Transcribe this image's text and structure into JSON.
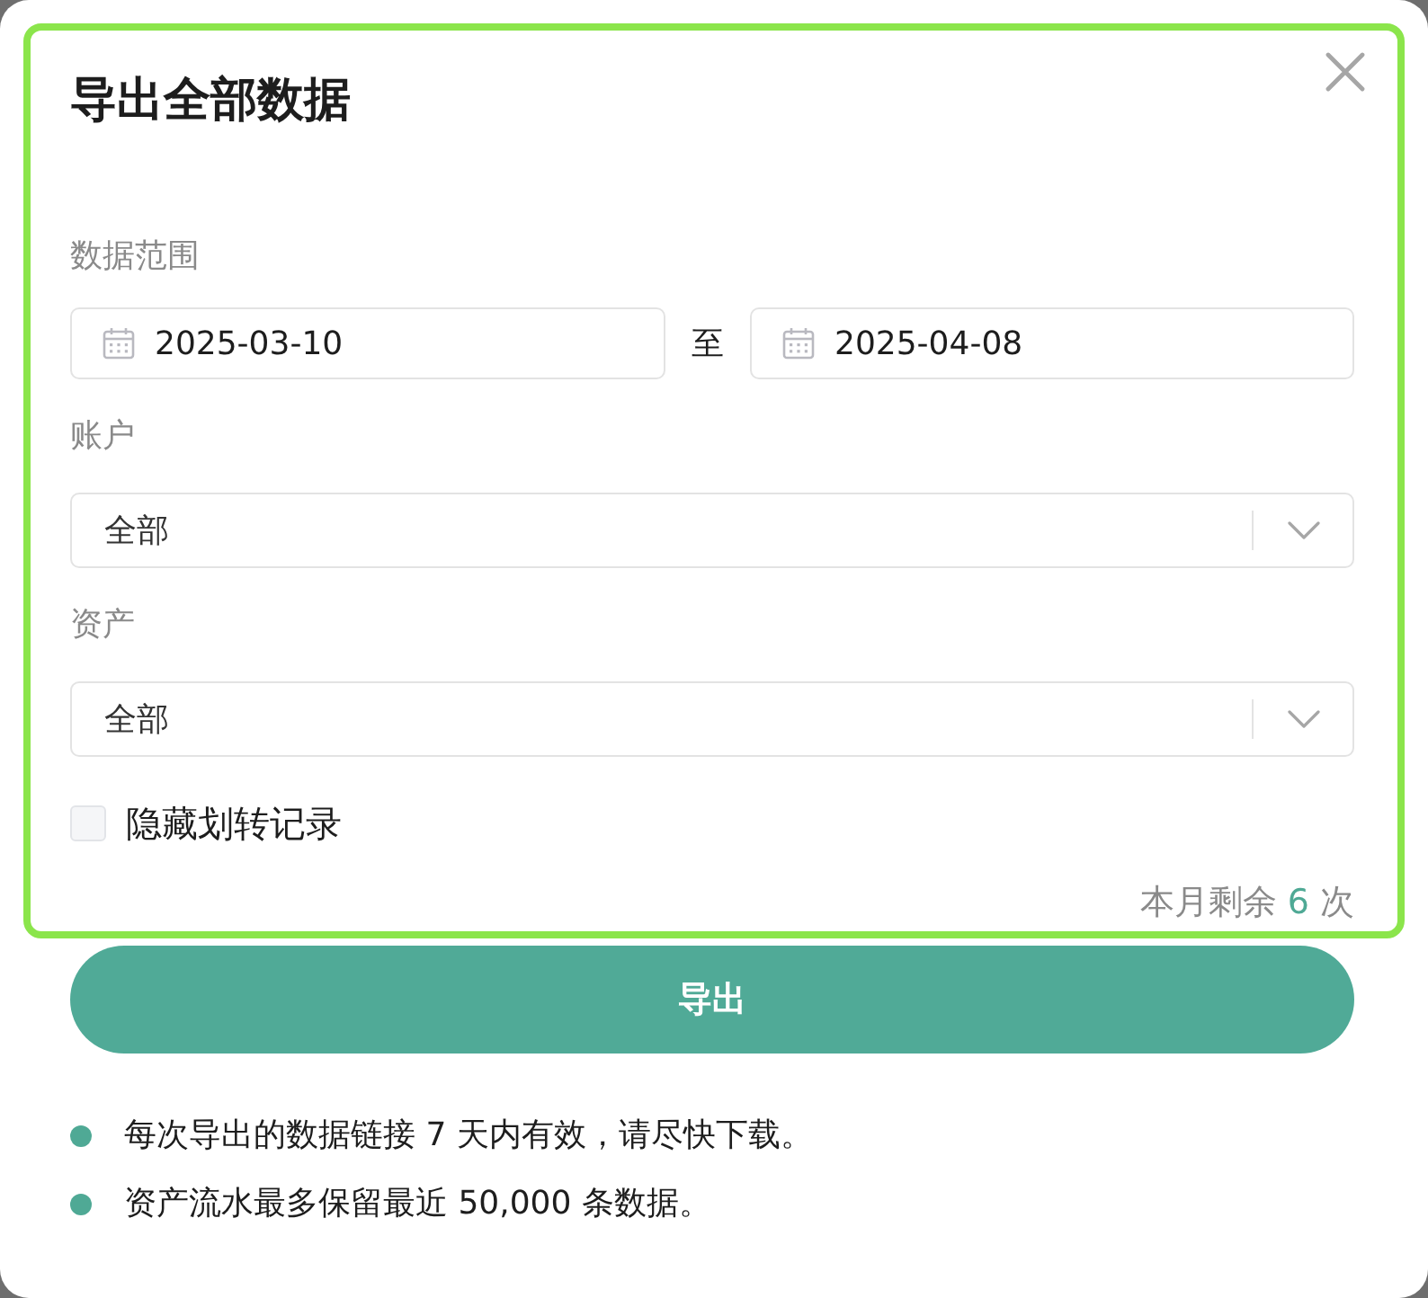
{
  "dialog": {
    "title": "导出全部数据"
  },
  "form": {
    "highlighted": true,
    "date_range": {
      "label": "数据范围",
      "start": "2025-03-10",
      "separator": "至",
      "end": "2025-04-08"
    },
    "fields": [
      {
        "label": "账户",
        "value": "全部"
      },
      {
        "label": "资产",
        "value": "全部"
      }
    ],
    "hide_transfers": {
      "label": "隐藏划转记录",
      "checked": false
    },
    "quota": {
      "prefix": "本月剩余",
      "count": "6",
      "suffix": "次"
    }
  },
  "export_button": {
    "label": "导出"
  },
  "notes": [
    "每次导出的数据链接 7 天内有效，请尽快下载。",
    "资产流水最多保留最近 50,000 条数据。"
  ]
}
